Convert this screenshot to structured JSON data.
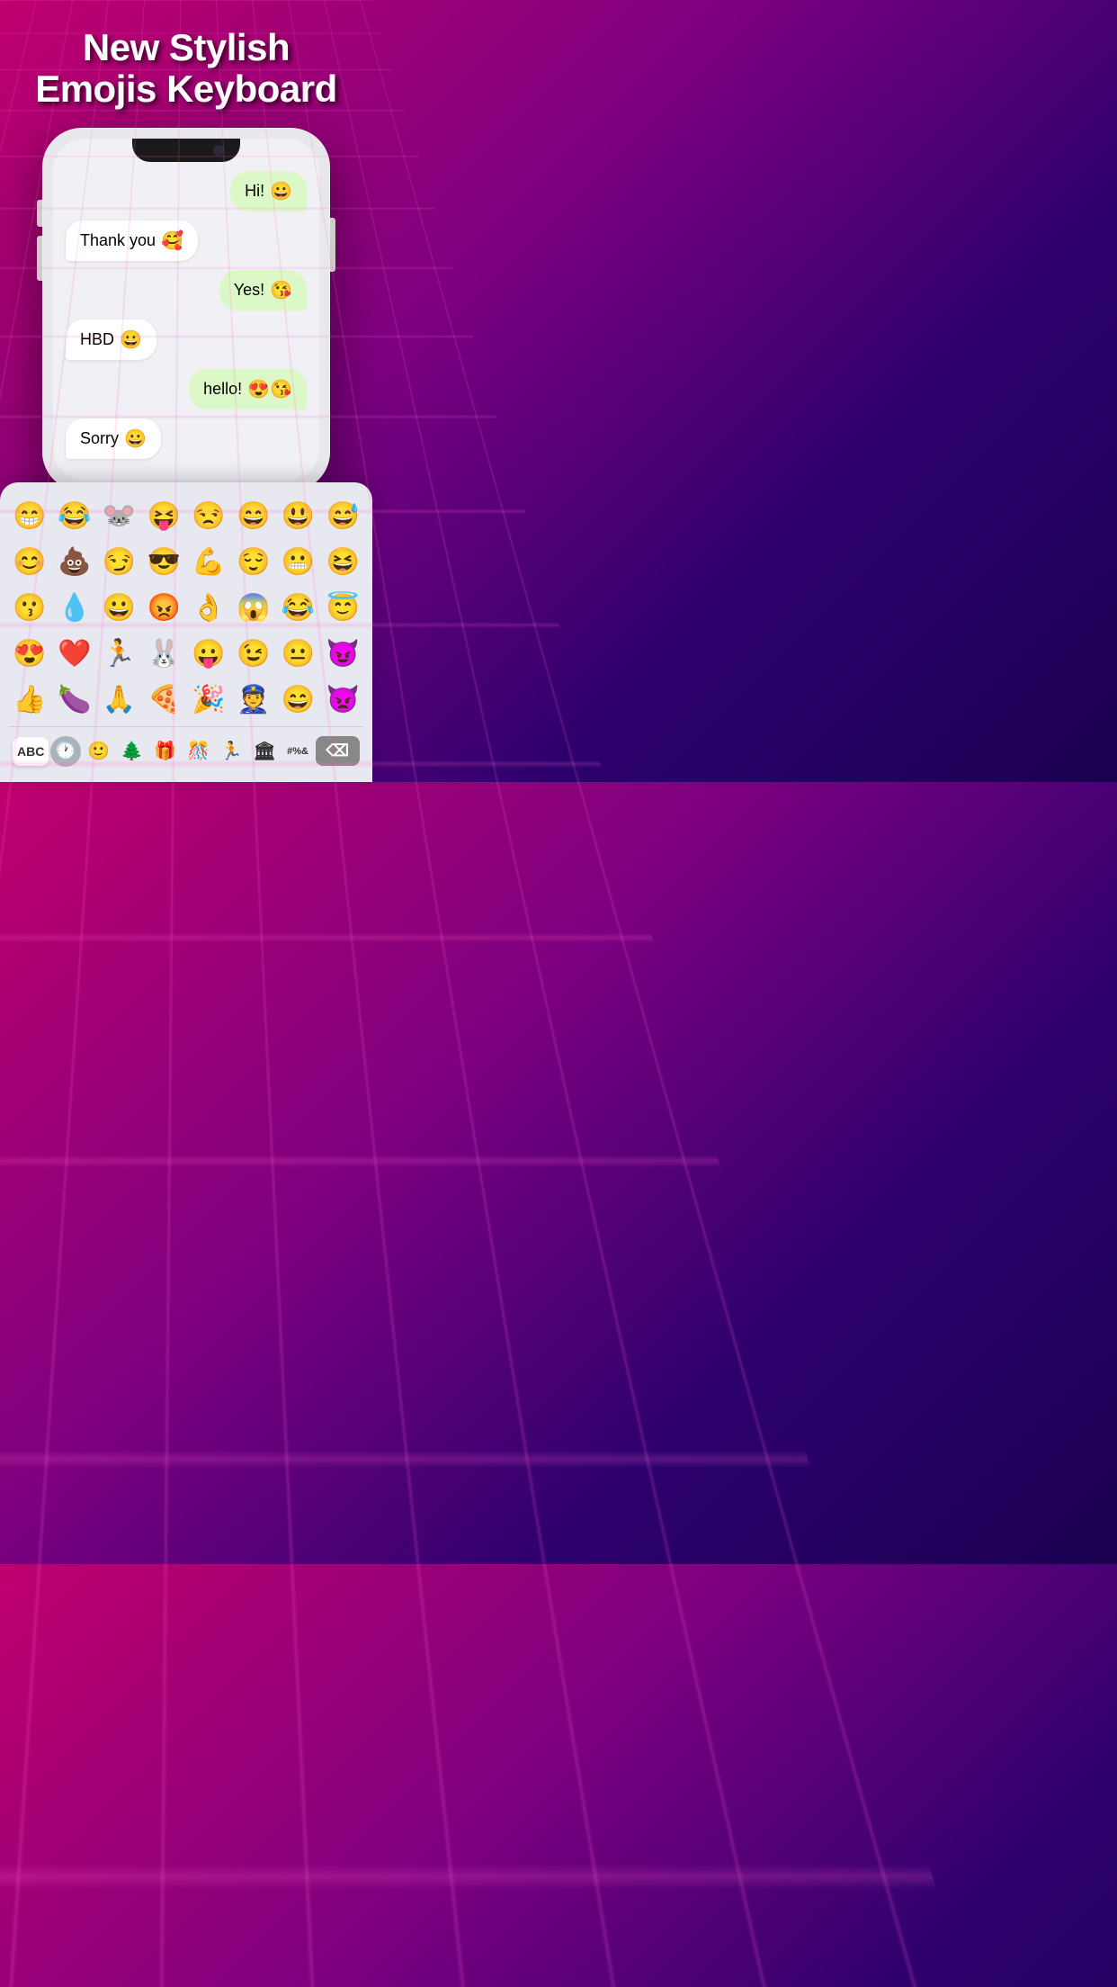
{
  "header": {
    "title_line1": "New Stylish",
    "title_line2": "Emojis Keyboard"
  },
  "chat": {
    "messages": [
      {
        "id": 1,
        "text": "Hi!",
        "emoji": "😀",
        "type": "sent"
      },
      {
        "id": 2,
        "text": "Thank you",
        "emoji": "🥰",
        "type": "received"
      },
      {
        "id": 3,
        "text": "Yes!",
        "emoji": "😘",
        "type": "sent"
      },
      {
        "id": 4,
        "text": "HBD",
        "emoji": "😀",
        "type": "received"
      },
      {
        "id": 5,
        "text": "hello!",
        "emoji": "😍😘",
        "type": "sent"
      },
      {
        "id": 6,
        "text": "Sorry",
        "emoji": "😀",
        "type": "received"
      }
    ]
  },
  "keyboard": {
    "emojis_row1": [
      "😁",
      "😂",
      "🐭",
      "😝",
      "😒",
      "😄",
      "😃",
      "😅"
    ],
    "emojis_row2": [
      "😊",
      "💩",
      "😏",
      "😎",
      "💪",
      "😌",
      "😬",
      "😆"
    ],
    "emojis_row3": [
      "😗",
      "💧",
      "😀",
      "😡",
      "👌",
      "😱",
      "😂",
      "😇"
    ],
    "emojis_row4": [
      "😍",
      "❤️",
      "🏃",
      "🐰",
      "😛",
      "😉",
      "😐",
      "😈"
    ],
    "emojis_row5": [
      "👍",
      "🍆",
      "🙏",
      "🍕",
      "🎉",
      "👮",
      "😄",
      "👿"
    ],
    "bottom_labels": {
      "abc": "ABC",
      "clock_icon": "🕐",
      "face_icon": "🙂",
      "tree_icon": "🌲",
      "gift_icon": "🎁",
      "party_icon": "🎊",
      "run_icon": "🏃",
      "building_icon": "🏛",
      "symbol_icon": "🔣",
      "delete": "⌫"
    }
  }
}
